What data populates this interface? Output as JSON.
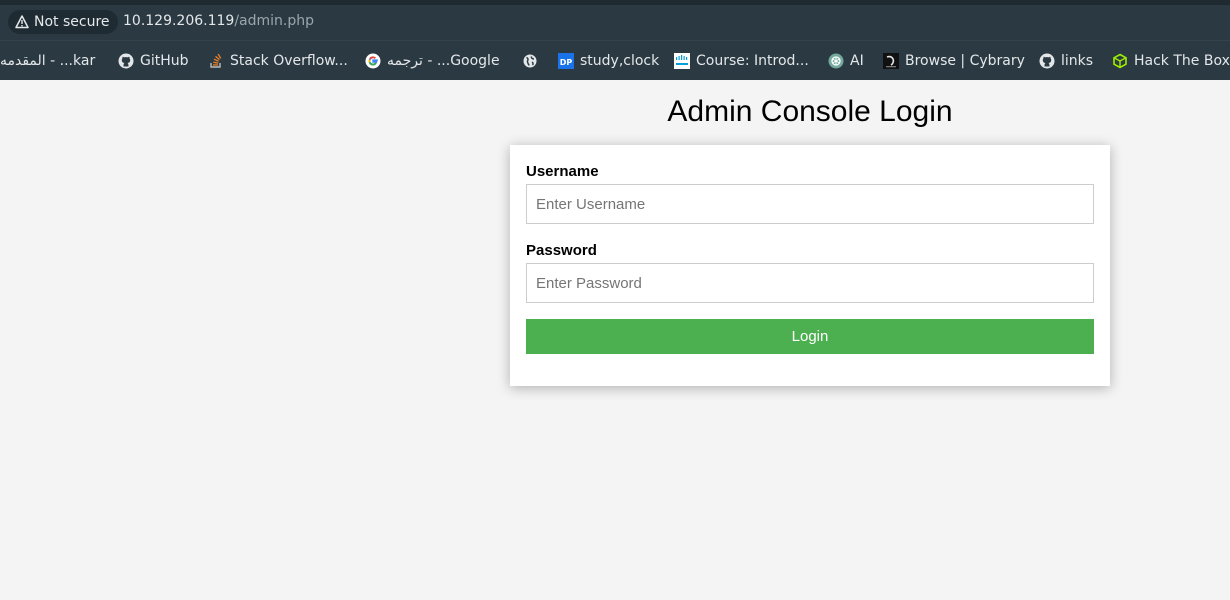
{
  "browser": {
    "security_label": "Not secure",
    "url_host": "10.129.206.119",
    "url_path": "/admin.php"
  },
  "bookmarks": [
    {
      "label": "kar... - المقدمه",
      "icon": "none"
    },
    {
      "label": "GitHub",
      "icon": "github-icon"
    },
    {
      "label": "Stack Overflow...",
      "icon": "stackoverflow-icon"
    },
    {
      "label": "Google... - ترجمه",
      "icon": "google-icon"
    },
    {
      "label": "",
      "icon": "globe-icon"
    },
    {
      "label": "study,clock",
      "icon": "dp-icon"
    },
    {
      "label": "Course: Introd...",
      "icon": "cisco-icon"
    },
    {
      "label": "AI",
      "icon": "openai-icon"
    },
    {
      "label": "Browse | Cybrary",
      "icon": "cybrary-icon"
    },
    {
      "label": "links",
      "icon": "github-icon"
    },
    {
      "label": "Hack The Box",
      "icon": "htb-icon"
    }
  ],
  "page": {
    "title": "Admin Console Login",
    "username_label": "Username",
    "username_placeholder": "Enter Username",
    "username_value": "",
    "password_label": "Password",
    "password_placeholder": "Enter Password",
    "password_value": "",
    "login_label": "Login"
  },
  "colors": {
    "chrome_bg": "#2b3a42",
    "page_bg": "#f4f4f4",
    "button_green": "#4caf50"
  }
}
